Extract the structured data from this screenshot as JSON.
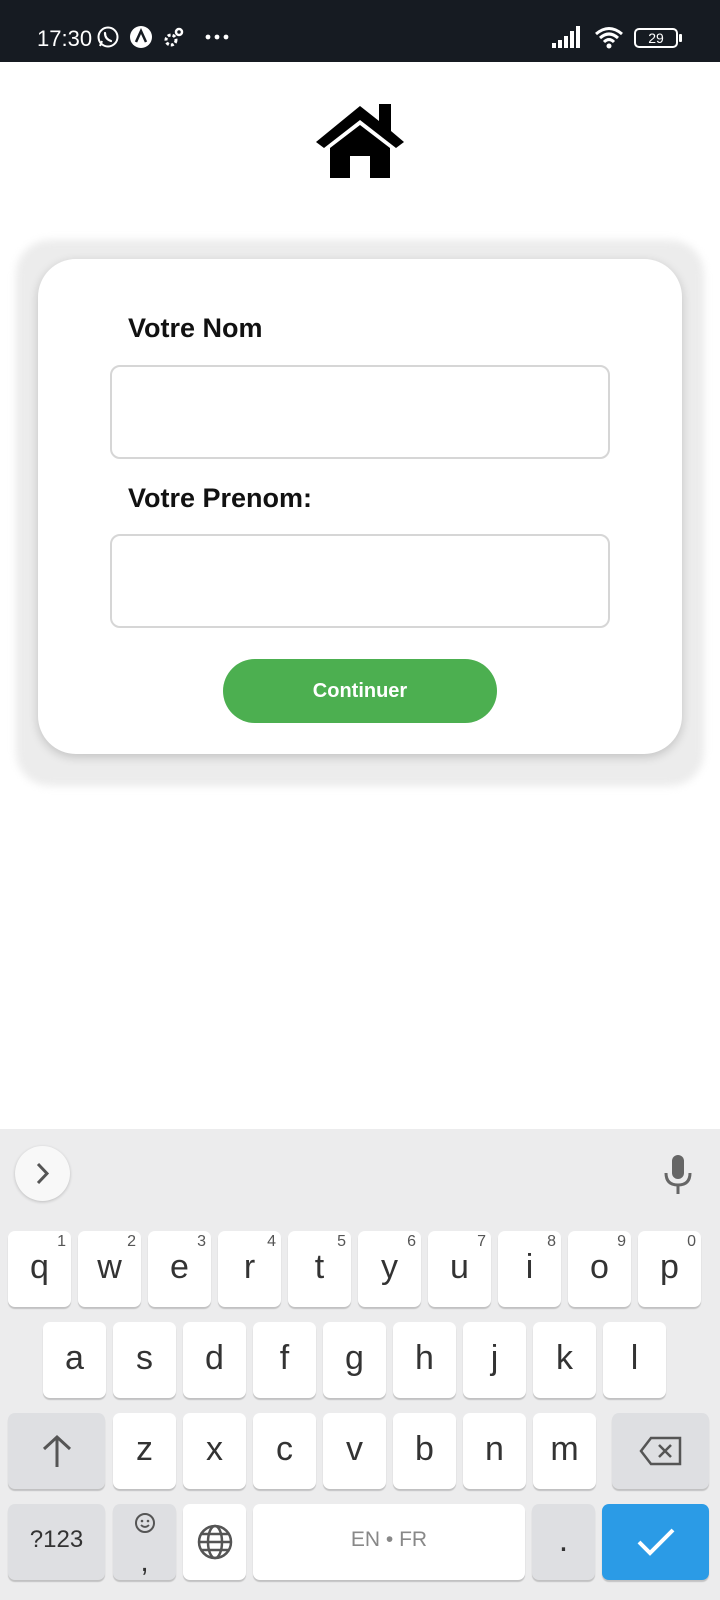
{
  "status_bar": {
    "time": "17:30",
    "battery": "29",
    "icons": [
      "whatsapp-icon",
      "app-icon",
      "settings-icon",
      "more-icon",
      "signal-icon",
      "wifi-icon",
      "battery-icon"
    ]
  },
  "header": {
    "icon": "home-icon"
  },
  "form": {
    "name_label": "Votre Nom",
    "name_value": "",
    "firstname_label": "Votre Prenom:",
    "firstname_value": "",
    "continue_label": "Continuer",
    "accent": "#4caf50"
  },
  "keyboard": {
    "row1": [
      {
        "k": "q",
        "n": "1"
      },
      {
        "k": "w",
        "n": "2"
      },
      {
        "k": "e",
        "n": "3"
      },
      {
        "k": "r",
        "n": "4"
      },
      {
        "k": "t",
        "n": "5"
      },
      {
        "k": "y",
        "n": "6"
      },
      {
        "k": "u",
        "n": "7"
      },
      {
        "k": "i",
        "n": "8"
      },
      {
        "k": "o",
        "n": "9"
      },
      {
        "k": "p",
        "n": "0"
      }
    ],
    "row2": [
      "a",
      "s",
      "d",
      "f",
      "g",
      "h",
      "j",
      "k",
      "l"
    ],
    "row3": [
      "z",
      "x",
      "c",
      "v",
      "b",
      "n",
      "m"
    ],
    "symbols_label": "?123",
    "comma_label": ",",
    "space_label": "EN • FR",
    "period_label": ".",
    "enter_color": "#2b9be6"
  }
}
